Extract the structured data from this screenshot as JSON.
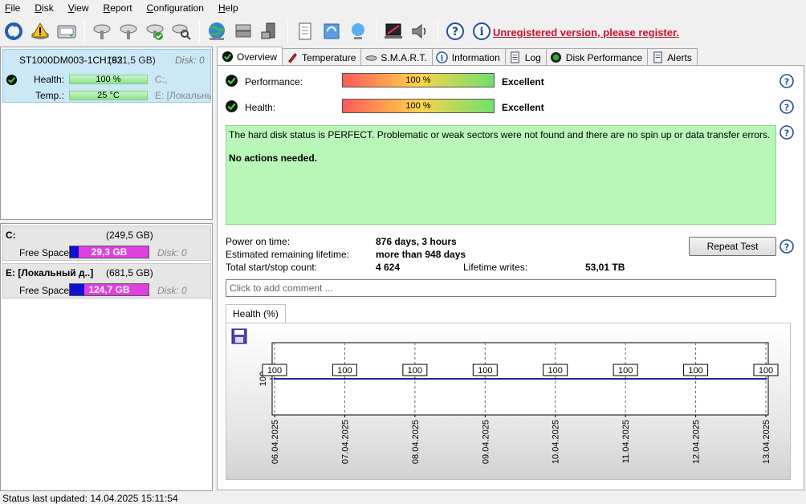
{
  "menu": [
    {
      "label": "File",
      "accel": "F"
    },
    {
      "label": "Disk",
      "accel": "D"
    },
    {
      "label": "View",
      "accel": "V"
    },
    {
      "label": "Report",
      "accel": "R"
    },
    {
      "label": "Configuration",
      "accel": "C"
    },
    {
      "label": "Help",
      "accel": "H"
    }
  ],
  "toolbar": {
    "unregistered": "Unregistered version, please register."
  },
  "disk": {
    "name": "ST1000DM003-1CH162",
    "size": "(931,5 GB)",
    "disk_num": "Disk: 0",
    "health_label": "Health:",
    "health_value": "100 %",
    "temp_label": "Temp.:",
    "temp_value": "25 °C",
    "drive_c": "C:,",
    "drive_e": "E: [Локальный"
  },
  "volumes": [
    {
      "name": "C:",
      "size": "(249,5 GB)",
      "fs_label": "Free Space",
      "free": "29,3 GB",
      "free_fraction": 0.117,
      "disk": "Disk: 0"
    },
    {
      "name": "E: [Локальный д..]",
      "size": "(681,5 GB)",
      "fs_label": "Free Space",
      "free": "124,7 GB",
      "free_fraction": 0.183,
      "disk": "Disk: 0"
    }
  ],
  "tabs": [
    {
      "label": "Overview",
      "active": true
    },
    {
      "label": "Temperature"
    },
    {
      "label": "S.M.A.R.T."
    },
    {
      "label": "Information"
    },
    {
      "label": "Log"
    },
    {
      "label": "Disk Performance"
    },
    {
      "label": "Alerts"
    }
  ],
  "overview": {
    "performance_label": "Performance:",
    "performance_value": "100 %",
    "performance_verdict": "Excellent",
    "health_label": "Health:",
    "health_value": "100 %",
    "health_verdict": "Excellent",
    "status_text": "The hard disk status is PERFECT. Problematic or weak sectors were not found and there are no spin up or data transfer errors.",
    "status_action": "No actions needed.",
    "power_on_label": "Power on time:",
    "power_on_value": "876 days, 3 hours",
    "remaining_label": "Estimated remaining lifetime:",
    "remaining_value": "more than 948 days",
    "startstop_label": "Total start/stop count:",
    "startstop_value": "4 624",
    "writes_label": "Lifetime writes:",
    "writes_value": "53,01 TB",
    "repeat_button": "Repeat Test",
    "comment_placeholder": "Click to add comment ..."
  },
  "chart_tab": "Health (%)",
  "chart_data": {
    "type": "line",
    "categories": [
      "06.04.2025",
      "07.04.2025",
      "08.04.2025",
      "09.04.2025",
      "10.04.2025",
      "11.04.2025",
      "12.04.2025",
      "13.04.2025"
    ],
    "series": [
      {
        "values": [
          100,
          100,
          100,
          100,
          100,
          100,
          100,
          100
        ]
      }
    ],
    "ylabel": "",
    "ytick": "100",
    "ylim": [
      0,
      200
    ],
    "grid": true,
    "line_color": "#1a2a9a"
  },
  "statusbar": "Status last updated: 14.04.2025 15:11:54"
}
